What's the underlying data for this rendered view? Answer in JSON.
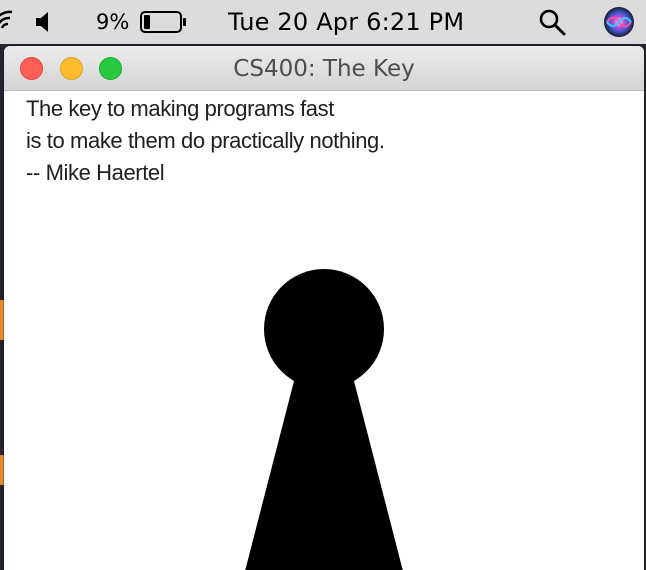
{
  "menubar": {
    "battery_percent": "9%",
    "battery_level": 0.09,
    "clock": "Tue 20 Apr  6:21 PM",
    "icons": [
      "wifi-icon",
      "speaker-icon",
      "battery-icon",
      "search-icon",
      "siri-icon"
    ]
  },
  "window": {
    "title": "CS400: The Key",
    "traffic_lights": {
      "close": "#fe5f57",
      "minimize": "#febc2e",
      "zoom": "#28c840"
    },
    "quote": {
      "line1": "The key to making programs fast",
      "line2": "is to make them do practically nothing.",
      "line3": "-- Mike Haertel"
    },
    "graphic": "keyhole"
  }
}
